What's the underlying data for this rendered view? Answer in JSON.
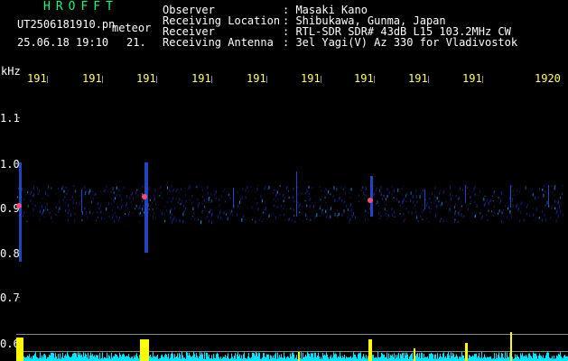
{
  "header": {
    "app_title": "HROFFT",
    "filename": "UT2506181910.pn",
    "tag": "meteor",
    "datetime": "25.06.18 19:10",
    "extra": "21.",
    "fields": [
      {
        "label": "Observer",
        "value": ": Masaki Kano"
      },
      {
        "label": "Receiving Location",
        "value": ": Shibukawa, Gunma, Japan"
      },
      {
        "label": "Receiver",
        "value": ": RTL-SDR SDR# 43dB L15 103.2MHz CW"
      },
      {
        "label": "Receiving Antenna",
        "value": ": 3el Yagi(V) Az 330 for Vladivostok"
      }
    ]
  },
  "axis": {
    "unit": "kHz",
    "y_labels": [
      "1.1",
      "1.0",
      "0.9",
      "0.8",
      "0.7",
      "0.6"
    ],
    "x_labels": [
      "191",
      "191",
      "191",
      "191",
      "191",
      "191",
      "191",
      "191",
      "191",
      "1920"
    ]
  },
  "colors": {
    "title": "#00ff7f",
    "time_labels": "#ffff66",
    "signal": "#ffff00",
    "noise": "#00e5ff"
  }
}
